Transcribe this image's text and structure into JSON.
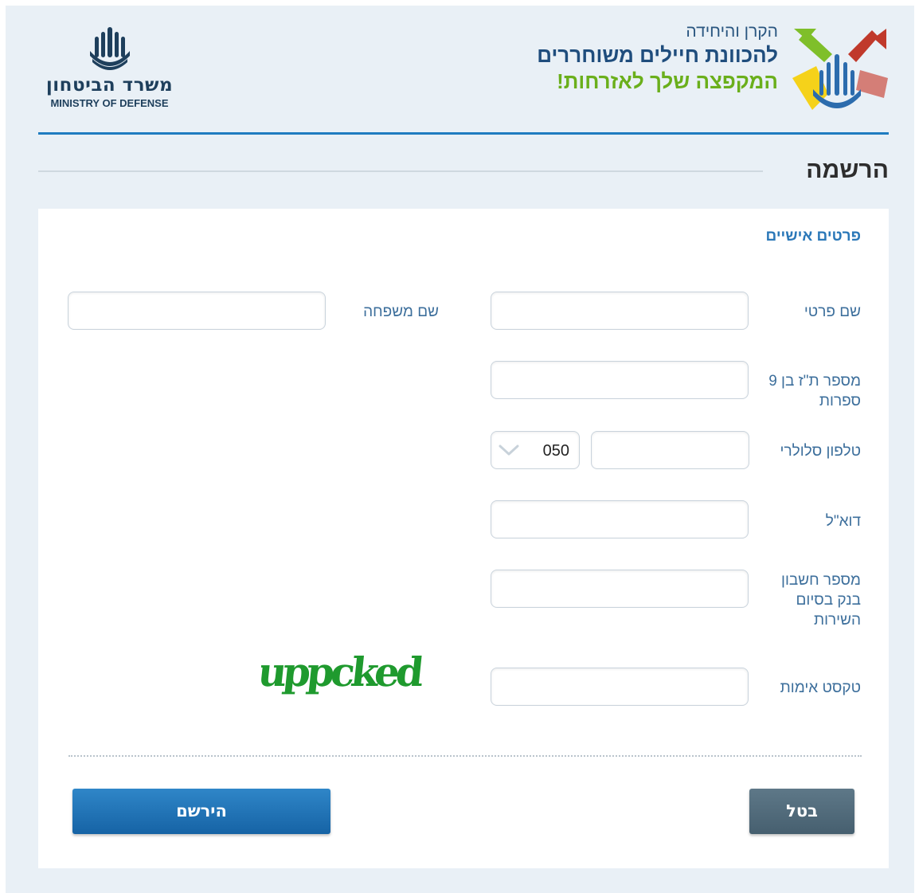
{
  "header": {
    "ministry_name_he": "משרד הביטחון",
    "ministry_name_en": "MINISTRY OF DEFENSE",
    "campaign": {
      "line1": "הקרן והיחידה",
      "line2": "להכוונת חיילים משוחררים",
      "line3": "המקפצה שלך לאזרחות!"
    }
  },
  "page_title": "הרשמה",
  "form": {
    "section_title": "פרטים אישיים",
    "fields": {
      "first_name": {
        "label": "שם פרטי",
        "value": ""
      },
      "last_name": {
        "label": "שם משפחה",
        "value": ""
      },
      "id_number": {
        "label": "מספר ת\"ז בן 9 ספרות",
        "value": ""
      },
      "mobile": {
        "label": "טלפון סלולרי",
        "number": "",
        "prefix": "050"
      },
      "email": {
        "label": "דוא\"ל",
        "value": ""
      },
      "bank_account": {
        "label": "מספר חשבון בנק בסיום השירות",
        "value": ""
      },
      "captcha": {
        "label": "טקסט אימות",
        "value": "",
        "image_text": "uppcked"
      }
    },
    "buttons": {
      "register": "הירשם",
      "cancel": "בטל"
    }
  },
  "colors": {
    "accent": "#1f7cc0",
    "label": "#3d6f9c",
    "register_button": "#1e72b6",
    "cancel_button": "#526b7b",
    "captcha_green": "#1f9a2e"
  }
}
